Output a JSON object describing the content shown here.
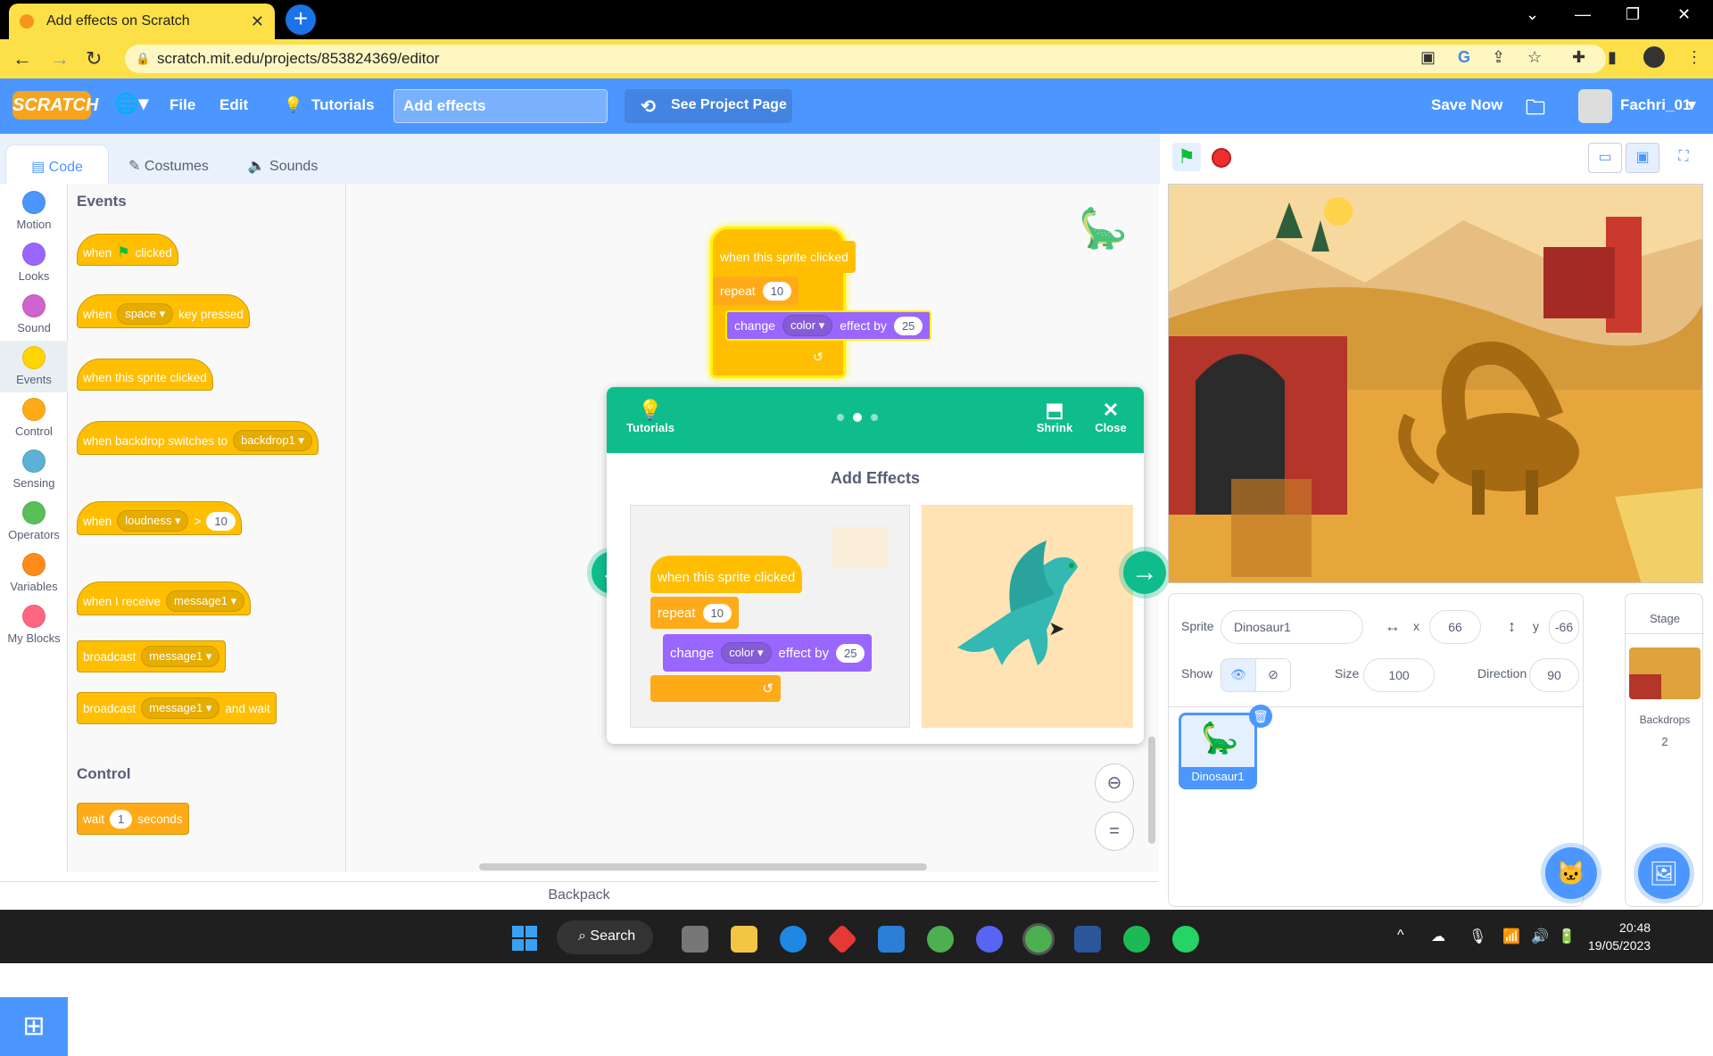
{
  "browser": {
    "tab_title": "Add effects on Scratch",
    "url": "scratch.mit.edu/projects/853824369/editor"
  },
  "menubar": {
    "logo": "SCRATCH",
    "file": "File",
    "edit": "Edit",
    "tutorials": "Tutorials",
    "project_title": "Add effects",
    "see_project": "See Project Page",
    "save_now": "Save Now",
    "username": "Fachri_01"
  },
  "editor_tabs": {
    "code": "Code",
    "costumes": "Costumes",
    "sounds": "Sounds"
  },
  "categories": [
    {
      "label": "Motion",
      "color": "#4c97ff"
    },
    {
      "label": "Looks",
      "color": "#9966ff"
    },
    {
      "label": "Sound",
      "color": "#cf63cf"
    },
    {
      "label": "Events",
      "color": "#ffd500"
    },
    {
      "label": "Control",
      "color": "#ffab19"
    },
    {
      "label": "Sensing",
      "color": "#5cb1d6"
    },
    {
      "label": "Operators",
      "color": "#59c059"
    },
    {
      "label": "Variables",
      "color": "#ff8c1a"
    },
    {
      "label": "My Blocks",
      "color": "#ff6680"
    }
  ],
  "palette": {
    "events_heading": "Events",
    "control_heading": "Control",
    "b1_when": "when",
    "b1_clicked": "clicked",
    "b2_when": "when",
    "b2_key": "space",
    "b2_pressed": "key pressed",
    "b3": "when this sprite clicked",
    "b4_text": "when backdrop switches to",
    "b4_dd": "backdrop1",
    "b5_when": "when",
    "b5_dd": "loudness",
    "b5_gt": ">",
    "b5_num": "10",
    "b6_text": "when I receive",
    "b6_dd": "message1",
    "b7_text": "broadcast",
    "b7_dd": "message1",
    "b8_text": "broadcast",
    "b8_dd": "message1",
    "b8_wait": "and wait",
    "b9_text": "wait",
    "b9_num": "1",
    "b9_sec": "seconds"
  },
  "script": {
    "hat": "when this sprite clicked",
    "repeat": "repeat",
    "repeat_num": "10",
    "change": "change",
    "effect": "color",
    "effect_by": "effect by",
    "effect_num": "25",
    "loop_arrow": "↺"
  },
  "tutorial": {
    "tutorials_label": "Tutorials",
    "shrink_label": "Shrink",
    "close_label": "Close",
    "title": "Add Effects",
    "hat": "when this sprite clicked",
    "repeat": "repeat",
    "repeat_num": "10",
    "change": "change",
    "effect": "color",
    "effect_by": "effect by",
    "effect_num": "25",
    "loop_arrow": "↺",
    "dots_active": 2,
    "dots_total": 3
  },
  "backpack": "Backpack",
  "sprite_info": {
    "sprite_label": "Sprite",
    "sprite_name": "Dinosaur1",
    "x_label": "x",
    "x_value": "66",
    "y_label": "y",
    "y_value": "-66",
    "show_label": "Show",
    "size_label": "Size",
    "size_value": "100",
    "direction_label": "Direction",
    "direction_value": "90",
    "tile_name": "Dinosaur1"
  },
  "stage_panel": {
    "title": "Stage",
    "backdrops_label": "Backdrops",
    "backdrops_count": "2"
  },
  "taskbar": {
    "search": "Search",
    "time": "20:48",
    "date": "19/05/2023"
  },
  "colors": {
    "scratch_blue": "#4c97ff",
    "events_yellow": "#ffbf00",
    "looks_purple": "#9966ff",
    "tutorial_green": "#0fbd8c"
  }
}
